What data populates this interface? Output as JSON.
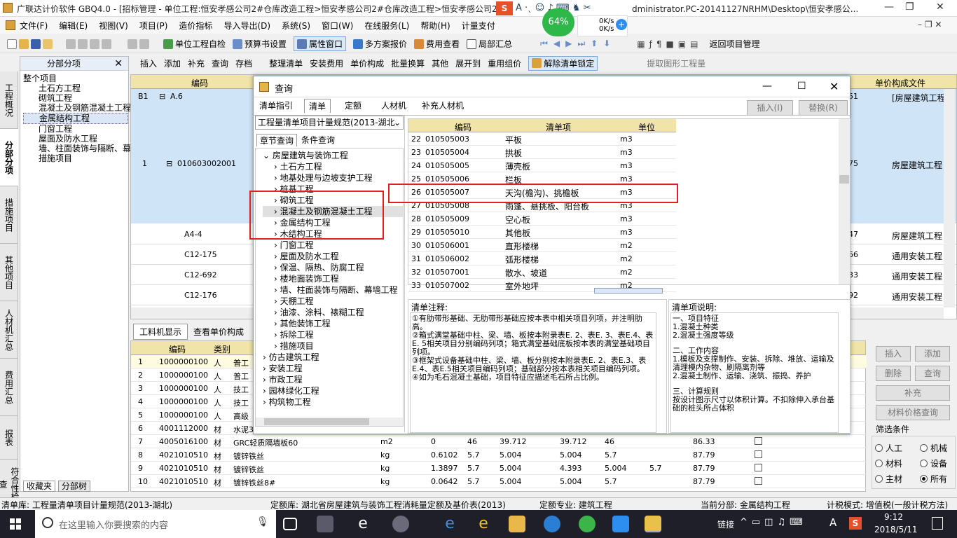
{
  "titlebar": {
    "title": "广联达计价软件 GBQ4.0 - [招标管理 - 单位工程:恒安孝感公司2#仓库改造工程>恒安孝感公司2#仓库改造工程>恒安孝感公司2#仓",
    "title_right": "dministrator.PC-20141127NRHM\\Desktop\\恒安孝感公...",
    "net_pct": "64%",
    "net_up": "0K/s",
    "net_down": "0K/s"
  },
  "menubar": [
    "文件(F)",
    "编辑(E)",
    "视图(V)",
    "项目(P)",
    "造价指标",
    "导入导出(D)",
    "系统(S)",
    "窗口(W)",
    "在线服务(L)",
    "帮助(H)",
    "计量支付"
  ],
  "toolbar1": {
    "self_check": "单位工程自检",
    "budget_settings": "预算书设置",
    "attr_window": "属性窗口",
    "multi_plan": "多方案报价",
    "fee_view": "费用查看",
    "partial_total": "局部汇总",
    "back_project": "返回项目管理"
  },
  "toolbar2": [
    "插入",
    "添加",
    "补充",
    "查询",
    "存档",
    "整理清单",
    "安装费用",
    "单价构成",
    "批量换算",
    "其他",
    "展开到",
    "重用组价",
    "解除清单锁定",
    "提取图形工程量"
  ],
  "vtabs": [
    "工程概况",
    "分部分项",
    "措施项目",
    "其他项目",
    "人材机汇总",
    "费用汇总",
    "报表",
    "符合性检查"
  ],
  "leftpanel": {
    "header": "分部分项",
    "items": [
      "整个项目",
      "土石方工程",
      "砌筑工程",
      "混凝土及钢筋混凝土工程",
      "金属结构工程",
      "门窗工程",
      "屋面及防水工程",
      "墙、柱面装饰与隔断、幕",
      "措施项目"
    ],
    "bottom_tabs": [
      "收藏夹",
      "分部树"
    ]
  },
  "maingrid": {
    "col_code": "编码",
    "col_unitfile": "单价构成文件",
    "rows": [
      {
        "idx": "B1",
        "code": "A.6",
        "num": "51",
        "file": "[房屋建筑工程]"
      },
      {
        "idx": "1",
        "code": "010603002001",
        "num": "75",
        "file": "房屋建筑工程"
      },
      {
        "idx": "",
        "code": "A4-4",
        "num": "47",
        "file": "房屋建筑工程"
      },
      {
        "idx": "",
        "code": "C12-175",
        "num": "66",
        "file": "通用安装工程"
      },
      {
        "idx": "",
        "code": "C12-692",
        "num": "33",
        "file": "通用安装工程"
      },
      {
        "idx": "",
        "code": "C12-176",
        "num": "92",
        "file": "通用安装工程"
      }
    ]
  },
  "dialog": {
    "title": "查询",
    "tabs": [
      "清单指引",
      "清单",
      "定额",
      "人材机",
      "补充人材机"
    ],
    "insert_btn": "插入(I)",
    "replace_btn": "替换(R)",
    "dropdown": "工程量清单项目计量规范(2013-湖北",
    "subtabs": [
      "章节查询",
      "条件查询"
    ],
    "tree": {
      "root": "房屋建筑与装饰工程",
      "children": [
        "土石方工程",
        "地基处理与边坡支护工程",
        "桩基工程",
        "砌筑工程",
        "混凝土及钢筋混凝土工程",
        "金属结构工程",
        "木结构工程",
        "门窗工程",
        "屋面及防水工程",
        "保温、隔热、防腐工程",
        "楼地面装饰工程",
        "墙、柱面装饰与隔断、幕墙工程",
        "天棚工程",
        "油漆、涂料、裱糊工程",
        "其他装饰工程",
        "拆除工程",
        "措施项目"
      ],
      "others": [
        "仿古建筑工程",
        "安装工程",
        "市政工程",
        "园林绿化工程",
        "构筑物工程"
      ]
    },
    "list_headers": [
      "编码",
      "清单项",
      "单位"
    ],
    "list": [
      [
        "22",
        "010505003",
        "平板",
        "m3"
      ],
      [
        "23",
        "010505004",
        "拱板",
        "m3"
      ],
      [
        "24",
        "010505005",
        "薄壳板",
        "m3"
      ],
      [
        "25",
        "010505006",
        "栏板",
        "m3"
      ],
      [
        "26",
        "010505007",
        "天沟(檐沟)、挑檐板",
        "m3"
      ],
      [
        "27",
        "010505008",
        "雨篷、悬挑板、阳台板",
        "m3"
      ],
      [
        "28",
        "010505009",
        "空心板",
        "m3"
      ],
      [
        "29",
        "010505010",
        "其他板",
        "m3"
      ],
      [
        "30",
        "010506001",
        "直形楼梯",
        "m2"
      ],
      [
        "31",
        "010506002",
        "弧形楼梯",
        "m2"
      ],
      [
        "32",
        "010507001",
        "散水、坡道",
        "m2"
      ],
      [
        "33",
        "010507002",
        "室外地坪",
        "m2"
      ]
    ],
    "notes_title": "清单注释:",
    "notes": [
      "①有肋带形基础、无肋带形基础应按本表中相关项目列项，并注明肋高。",
      "②箱式满堂基础中柱、梁、墙、板按本附录表E. 2、表E. 3、表E.4、表E. 5相关项目分别编码列项；箱式满堂基础底板按本表的满堂基础项目列项。",
      "③框架式设备基础中柱、梁、墙、板分别按本附录表E. 2、表E.3、表E.4、表E.5相关项目编码列项；基础部分按本表相关项目编码列项。",
      "④如为毛石混凝土基础，项目特征应描述毛石所占比例。"
    ],
    "desc_title": "清单项说明:",
    "desc": [
      "一、项目特征",
      "1.混凝土种类",
      "2.混凝土强度等级",
      "",
      "二、工作内容",
      "1.模板及支撑制作、安装、拆除、堆放、运输及清理模内杂物、刷隔离剂等",
      "2.混凝土制作、运输、浇筑、振捣、养护",
      "",
      "三、计算规则",
      "  按设计图示尺寸以体积计算。不扣除伸入承台基础的桩头所占体积"
    ]
  },
  "lowertabs": [
    "工料机显示",
    "查看单价构成"
  ],
  "lowergrid": {
    "headers": [
      "编码",
      "类别"
    ],
    "rows": [
      [
        "1",
        "1000000100",
        "人",
        "普工",
        "",
        "",
        "",
        "",
        "",
        "",
        "",
        ""
      ],
      [
        "2",
        "1000000100",
        "人",
        "普工",
        "",
        "",
        "",
        "",
        "",
        "",
        "",
        ""
      ],
      [
        "3",
        "1000000100",
        "人",
        "技工",
        "",
        "",
        "",
        "",
        "",
        "",
        "",
        ""
      ],
      [
        "4",
        "1000000100",
        "人",
        "技工",
        "",
        "",
        "",
        "",
        "",
        "",
        "",
        ""
      ],
      [
        "5",
        "1000000100",
        "人",
        "高级",
        "",
        "",
        "",
        "",
        "",
        "",
        "",
        ""
      ],
      [
        "6",
        "4001112000",
        "材",
        "水泥3",
        "",
        "",
        "",
        "",
        "",
        "",
        "",
        ""
      ],
      [
        "7",
        "4005016100",
        "材",
        "GRC轻质隔墙板60",
        "m2",
        "0",
        "46",
        "39.712",
        "39.712",
        "46",
        "",
        "86.33"
      ],
      [
        "8",
        "4021010510",
        "材",
        "镀锌铁丝",
        "kg",
        "0.6102",
        "5.7",
        "5.004",
        "5.004",
        "5.7",
        "",
        "87.79"
      ],
      [
        "9",
        "4021010510",
        "材",
        "镀锌铁丝",
        "kg",
        "1.3897",
        "5.7",
        "5.004",
        "4.393",
        "5.004",
        "5.7",
        "87.79"
      ],
      [
        "10",
        "4021010510",
        "材",
        "镀锌铁丝8#",
        "kg",
        "0.0642",
        "5.7",
        "5.004",
        "5.004",
        "5.7",
        "",
        "87.79"
      ]
    ]
  },
  "rightpanel": {
    "insert": "插入",
    "add": "添加",
    "delete": "删除",
    "query": "查询",
    "supplement": "补充",
    "price_query": "材料价格查询",
    "filter": "筛选条件",
    "radios": [
      "人工",
      "机械",
      "材料",
      "设备",
      "主材",
      "所有"
    ]
  },
  "statusbar": {
    "list_lib": "清单库: 工程量清单项目计量规范(2013-湖北)",
    "quota_lib": "定额库: 湖北省房屋建筑与装饰工程消耗量定额及基价表(2013)",
    "quota_major": "定额专业: 建筑工程",
    "current": "当前分部: 金属结构工程",
    "tax_mode": "计税模式: 增值税(一般计税方法)"
  },
  "taskbar": {
    "search_placeholder": "在这里输入你要搜索的内容",
    "link": "链接",
    "ime": "A",
    "time": "9:12",
    "date": "2018/5/11"
  }
}
